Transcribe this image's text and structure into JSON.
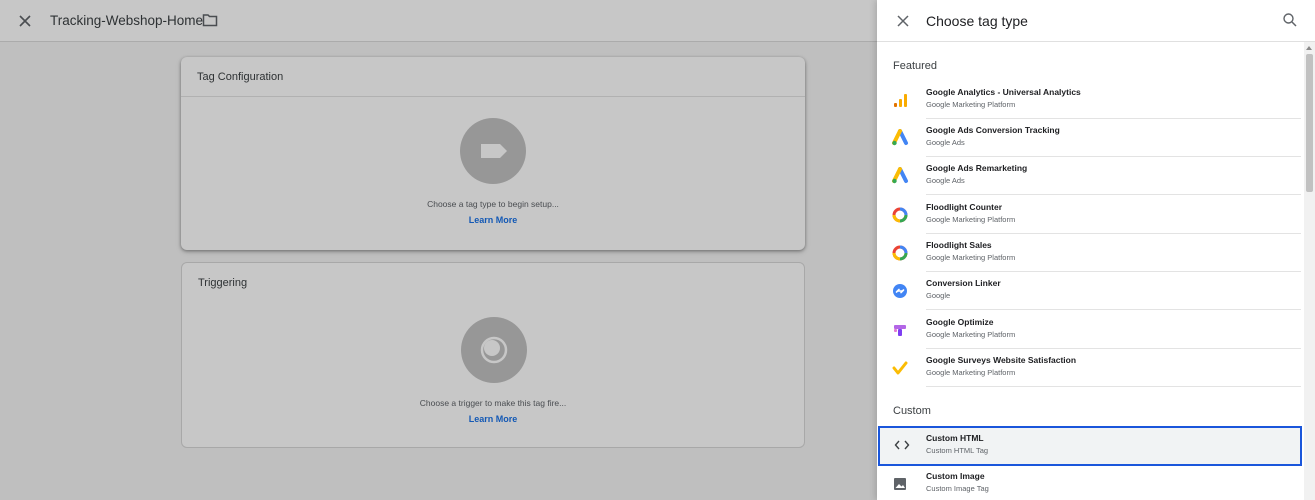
{
  "editor": {
    "title": "Tracking-Webshop-Home",
    "tag_configuration": {
      "title": "Tag Configuration",
      "hint": "Choose a tag type to begin setup...",
      "learn_more": "Learn More"
    },
    "triggering": {
      "title": "Triggering",
      "hint": "Choose a trigger to make this tag fire...",
      "learn_more": "Learn More"
    }
  },
  "panel": {
    "title": "Choose tag type",
    "featured_label": "Featured",
    "custom_label": "Custom",
    "featured": [
      {
        "name": "Google Analytics - Universal Analytics",
        "sub": "Google Marketing Platform",
        "icon": "google-analytics-icon"
      },
      {
        "name": "Google Ads Conversion Tracking",
        "sub": "Google Ads",
        "icon": "google-ads-icon"
      },
      {
        "name": "Google Ads Remarketing",
        "sub": "Google Ads",
        "icon": "google-ads-icon"
      },
      {
        "name": "Floodlight Counter",
        "sub": "Google Marketing Platform",
        "icon": "floodlight-icon"
      },
      {
        "name": "Floodlight Sales",
        "sub": "Google Marketing Platform",
        "icon": "floodlight-icon"
      },
      {
        "name": "Conversion Linker",
        "sub": "Google",
        "icon": "conversion-linker-icon"
      },
      {
        "name": "Google Optimize",
        "sub": "Google Marketing Platform",
        "icon": "google-optimize-icon"
      },
      {
        "name": "Google Surveys Website Satisfaction",
        "sub": "Google Marketing Platform",
        "icon": "google-surveys-icon"
      }
    ],
    "custom": [
      {
        "name": "Custom HTML",
        "sub": "Custom HTML Tag",
        "icon": "code-icon",
        "selected": true
      },
      {
        "name": "Custom Image",
        "sub": "Custom Image Tag",
        "icon": "image-icon"
      }
    ]
  },
  "colors": {
    "accent": "#1a73e8",
    "selection_border": "#1a56db",
    "analytics_orange": "#f9ab00",
    "ads_blue": "#4285f4",
    "ads_yellow": "#fbbc04",
    "ads_green": "#34a853",
    "floodlight_red": "#ea4335",
    "optimize_purple": "#b366e6"
  }
}
